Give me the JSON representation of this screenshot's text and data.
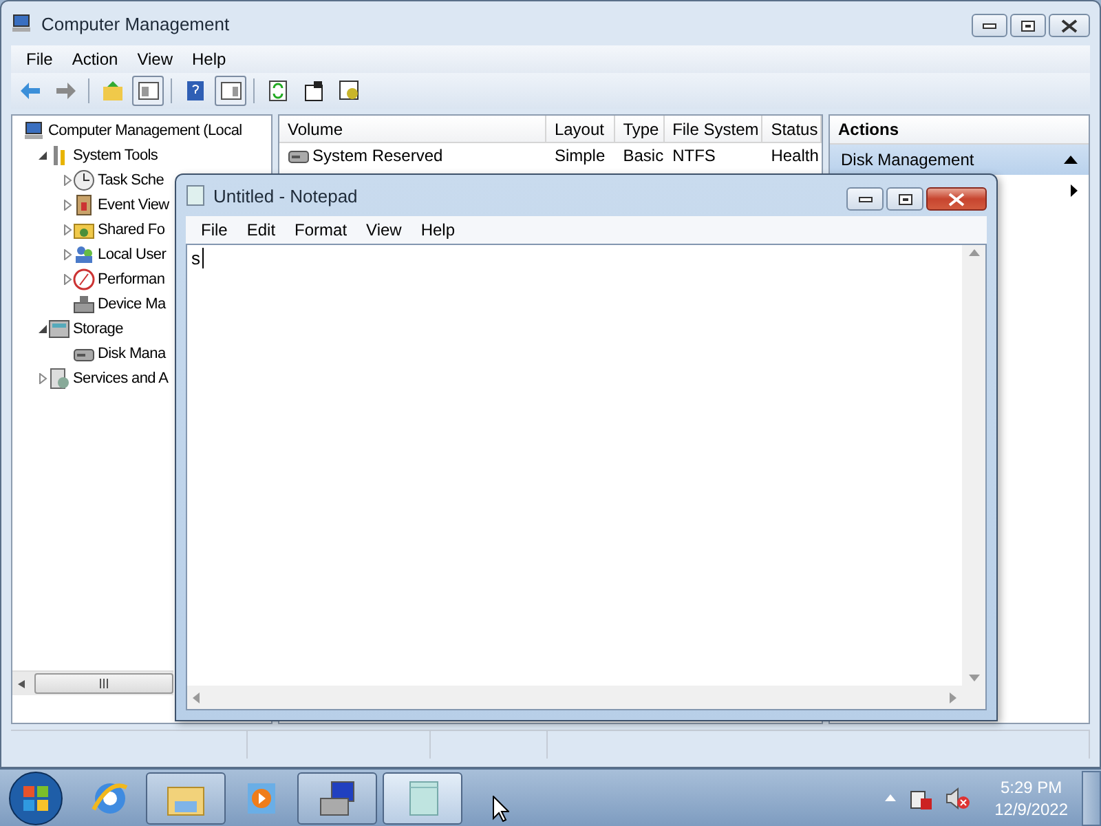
{
  "cm_window": {
    "title": "Computer Management",
    "menu": [
      "File",
      "Action",
      "View",
      "Help"
    ],
    "toolbar": [
      {
        "kind": "back",
        "pressed": false
      },
      {
        "kind": "forward",
        "pressed": false
      },
      {
        "kind": "separator"
      },
      {
        "kind": "up",
        "pressed": false
      },
      {
        "kind": "tree",
        "pressed": true
      },
      {
        "kind": "separator"
      },
      {
        "kind": "help",
        "pressed": false
      },
      {
        "kind": "pane",
        "pressed": true
      },
      {
        "kind": "separator"
      },
      {
        "kind": "refresh",
        "pressed": false
      },
      {
        "kind": "properties",
        "pressed": false
      },
      {
        "kind": "settings",
        "pressed": false
      }
    ],
    "tree": [
      {
        "label": "Computer Management (Local",
        "kind": "computer",
        "children": [
          {
            "label": "System Tools",
            "kind": "tools",
            "expanded": true,
            "children": [
              {
                "label": "Task Sche",
                "kind": "clock",
                "expanded": false
              },
              {
                "label": "Event View",
                "kind": "log",
                "expanded": false
              },
              {
                "label": "Shared Fo",
                "kind": "share",
                "expanded": false
              },
              {
                "label": "Local User",
                "kind": "users",
                "expanded": false
              },
              {
                "label": "Performan",
                "kind": "gauge",
                "expanded": false
              },
              {
                "label": "Device Ma",
                "kind": "device"
              }
            ]
          },
          {
            "label": "Storage",
            "kind": "storage",
            "expanded": true,
            "children": [
              {
                "label": "Disk Mana",
                "kind": "disk"
              }
            ]
          },
          {
            "label": "Services and A",
            "kind": "services",
            "expanded": false
          }
        ]
      }
    ],
    "volumes": {
      "columns": [
        "Volume",
        "Layout",
        "Type",
        "File System",
        "Status"
      ],
      "rows": [
        [
          "System Reserved",
          "Simple",
          "Basic",
          "NTFS",
          "Health"
        ]
      ]
    },
    "actions": {
      "title": "Actions",
      "items": [
        {
          "kind": "section",
          "label": "Disk Management"
        },
        {
          "kind": "more"
        }
      ]
    }
  },
  "notepad": {
    "title": "Untitled - Notepad",
    "menu": [
      "File",
      "Edit",
      "Format",
      "View",
      "Help"
    ],
    "text": "s"
  },
  "taskbar": {
    "items": [
      {
        "kind": "browser",
        "open": false,
        "selected": false
      },
      {
        "kind": "folder",
        "open": true,
        "selected": false
      },
      {
        "kind": "media",
        "open": false,
        "selected": false
      },
      {
        "kind": "computer",
        "open": true,
        "selected": false
      },
      {
        "kind": "notepad",
        "open": true,
        "selected": true
      }
    ],
    "time": "5:29 PM",
    "date": "12/9/2022"
  }
}
